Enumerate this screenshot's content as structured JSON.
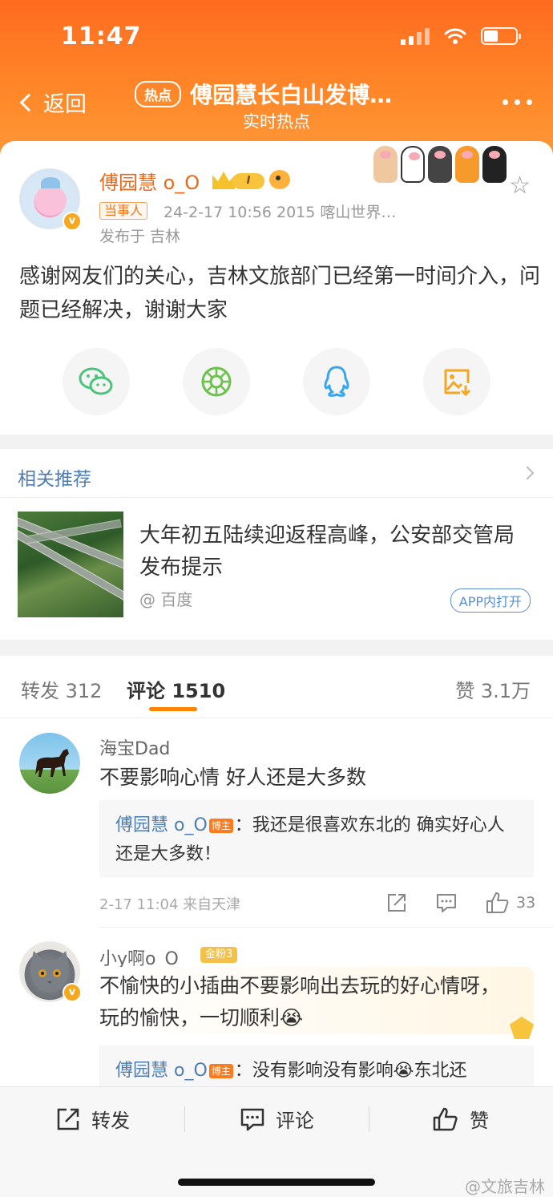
{
  "status_bar": {
    "time": "11:47"
  },
  "nav": {
    "back_label": "返回",
    "hot_tag": "热点",
    "title": "傅园慧长白山发博…",
    "subtitle": "实时热点"
  },
  "post": {
    "author": "傅园慧 o_O",
    "level": "I",
    "role_tag": "当事人",
    "meta": "24-2-17 10:56  2015 喀山世界…",
    "location": "发布于 吉林",
    "text": "感谢网友们的关心，吉林文旅部门已经第一时间介入，问题已经解决，谢谢大家",
    "share_icons": [
      "wechat-icon",
      "moments-icon",
      "qq-icon",
      "save-image-icon"
    ]
  },
  "related": {
    "title": "相关推荐",
    "headline": "大年初五陆续迎返程高峰，公安部交管局发布提示",
    "source": "@ 百度",
    "app_button": "APP内打开"
  },
  "comments_section": {
    "tabs": [
      {
        "label": "转发",
        "count": "312"
      },
      {
        "label": "评论",
        "count": "1510"
      }
    ],
    "likes": {
      "label": "赞",
      "count": "3.1万"
    },
    "comments": [
      {
        "name": "海宝Dad",
        "text": "不要影响心情 好人还是大多数",
        "reply_author": "傅园慧 o_O",
        "reply_tag": "博主",
        "reply_text": "：我还是很喜欢东北的 确实好心人还是大多数！",
        "meta": "2-17 11:04  来自天津",
        "like_count": "33"
      },
      {
        "name": "小y啊o_O",
        "fan_badge": "金粉3",
        "text": "不愉快的小插曲不要影响出去玩的好心情呀，玩的愉快，一切顺利😭",
        "reply_author": "傅园慧 o_O",
        "reply_tag": "博主",
        "reply_text": "：没有影响没有影响😭东北还"
      }
    ]
  },
  "bottom_bar": {
    "repost": "转发",
    "comment": "评论",
    "like": "赞"
  },
  "watermark": "@文旅吉林",
  "colors": {
    "header_orange": "#ff7a22",
    "link_blue": "#507daf",
    "accent_orange": "#ff8200"
  }
}
